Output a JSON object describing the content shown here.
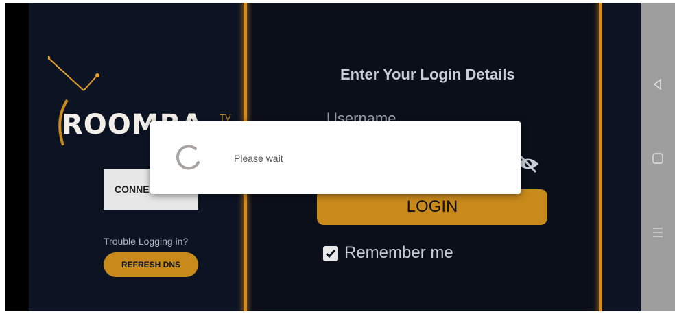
{
  "logo": {
    "word": "ROOMBA",
    "superscript": "TV"
  },
  "left": {
    "connect_label": "CONNE",
    "trouble_text": "Trouble Logging in?",
    "refresh_label": "REFRESH DNS"
  },
  "login": {
    "title": "Enter Your Login Details",
    "username_placeholder": "Username",
    "login_label": "LOGIN",
    "remember_label": "Remember me",
    "remember_checked": true
  },
  "dialog": {
    "message": "Please wait"
  },
  "colors": {
    "accent": "#c98a1c",
    "background": "#0b0f1a",
    "dialog": "#ffffff",
    "navbar": "#9e9e9e"
  },
  "icons": {
    "back": "back-icon",
    "home": "home-icon",
    "menu": "menu-icon",
    "eye": "eye-icon",
    "spinner": "spinner-icon"
  }
}
